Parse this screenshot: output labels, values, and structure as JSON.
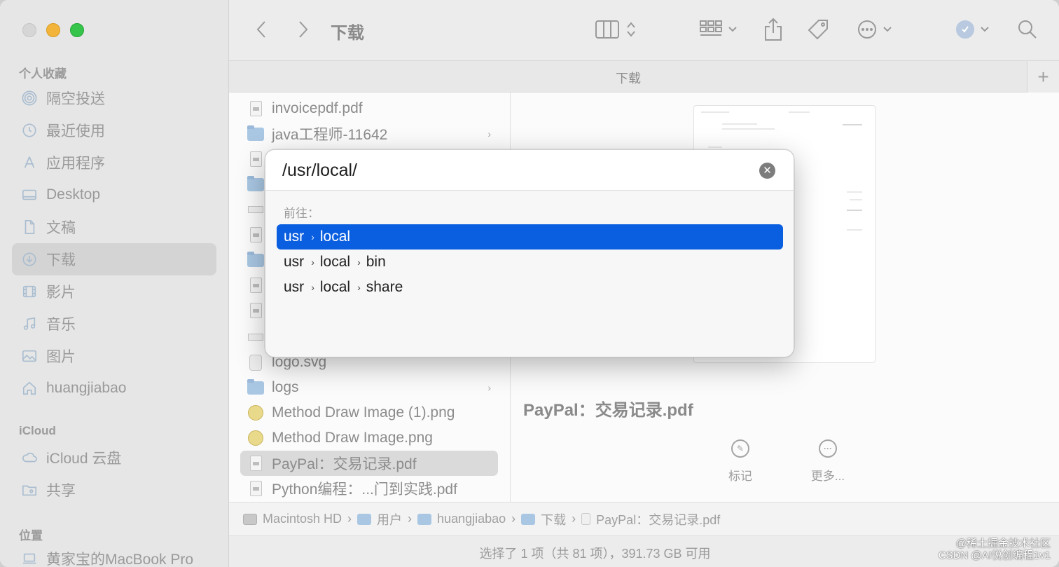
{
  "sidebar": {
    "favorites_header": "个人收藏",
    "items": [
      {
        "label": "隔空投送",
        "icon": "airdrop-icon"
      },
      {
        "label": "最近使用",
        "icon": "clock-icon"
      },
      {
        "label": "应用程序",
        "icon": "apps-icon"
      },
      {
        "label": "Desktop",
        "icon": "desktop-icon"
      },
      {
        "label": "文稿",
        "icon": "document-icon"
      },
      {
        "label": "下载",
        "icon": "download-icon",
        "selected": true
      },
      {
        "label": "影片",
        "icon": "film-icon"
      },
      {
        "label": "音乐",
        "icon": "music-icon"
      },
      {
        "label": "图片",
        "icon": "picture-icon"
      },
      {
        "label": "huangjiabao",
        "icon": "home-icon"
      }
    ],
    "icloud_header": "iCloud",
    "icloud_items": [
      {
        "label": "iCloud 云盘",
        "icon": "cloud-icon"
      },
      {
        "label": "共享",
        "icon": "shared-folder-icon"
      }
    ],
    "locations_header": "位置",
    "locations_items": [
      {
        "label": "黄家宝的MacBook Pro",
        "icon": "laptop-icon"
      }
    ]
  },
  "toolbar": {
    "title": "下载"
  },
  "tabbar": {
    "title": "下载",
    "add_label": "+"
  },
  "files": [
    {
      "name": "invoicepdf.pdf",
      "type": "doc"
    },
    {
      "name": "java工程师-11642",
      "type": "folder"
    },
    {
      "name": "logo.svg",
      "type": "svg"
    },
    {
      "name": "logs",
      "type": "folder"
    },
    {
      "name": "Method Draw Image (1).png",
      "type": "img"
    },
    {
      "name": "Method Draw Image.png",
      "type": "img"
    },
    {
      "name": "PayPal：交易记录.pdf",
      "type": "doc",
      "selected": true
    },
    {
      "name": "Python编程：...门到实践.pdf",
      "type": "doc"
    }
  ],
  "preview": {
    "title": "PayPal：交易记录.pdf",
    "actions": [
      {
        "label": "标记",
        "icon": "markup-icon"
      },
      {
        "label": "更多...",
        "icon": "more-icon"
      }
    ]
  },
  "pathbar": [
    "Macintosh HD",
    "用户",
    "huangjiabao",
    "下载",
    "PayPal：交易记录.pdf"
  ],
  "status": "选择了 1 项（共 81 项），391.73 GB 可用",
  "dialog": {
    "input_value": "/usr/local/",
    "go_label": "前往：",
    "results": [
      [
        "usr",
        "local"
      ],
      [
        "usr",
        "local",
        "bin"
      ],
      [
        "usr",
        "local",
        "share"
      ]
    ]
  },
  "watermark": {
    "line1": "@稀土掘金技术社区",
    "line2": "CSDN @AI悦创编程1v1"
  }
}
